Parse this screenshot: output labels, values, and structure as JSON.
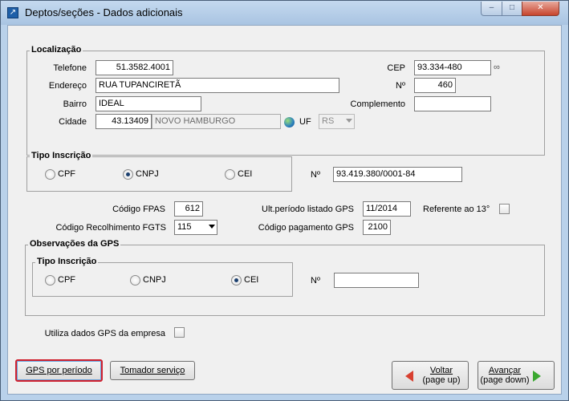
{
  "window": {
    "title": "Deptos/seções - Dados adicionais",
    "min": "–",
    "max": "□",
    "close": "✕"
  },
  "localizacao": {
    "title": "Localização",
    "telefone_label": "Telefone",
    "telefone": "51.3582.4001",
    "cep_label": "CEP",
    "cep": "93.334-480",
    "endereco_label": "Endereço",
    "endereco": "RUA TUPANCIRETÃ",
    "numero_label": "Nº",
    "numero": "460",
    "bairro_label": "Bairro",
    "bairro": "IDEAL",
    "complemento_label": "Complemento",
    "complemento": "",
    "cidade_label": "Cidade",
    "cidade_codigo": "43.13409",
    "cidade_nome": "NOVO HAMBURGO",
    "uf_label": "UF",
    "uf": "RS"
  },
  "tipo_inscricao": {
    "title": "Tipo Inscrição",
    "options": [
      "CPF",
      "CNPJ",
      "CEI"
    ],
    "selected": "CNPJ",
    "numero_label": "Nº",
    "numero": "93.419.380/0001-84"
  },
  "gps": {
    "fpas_label": "Código FPAS",
    "fpas": "612",
    "ult_periodo_label": "Ult.período listado GPS",
    "ult_periodo": "11/2014",
    "referente13_label": "Referente ao 13°",
    "referente13_checked": false,
    "recolhimento_label": "Código Recolhimento FGTS",
    "recolhimento": "115",
    "pagamento_label": "Código pagamento GPS",
    "pagamento": "2100"
  },
  "observacoes": {
    "title": "Observações da GPS",
    "tipo_title": "Tipo Inscrição",
    "options": [
      "CPF",
      "CNPJ",
      "CEI"
    ],
    "selected": "CEI",
    "numero_label": "Nº",
    "numero": ""
  },
  "utiliza_label": "Utiliza dados GPS da empresa",
  "utiliza_checked": false,
  "buttons": {
    "gps_periodo": "GPS por período",
    "tomador": "Tomador serviço",
    "voltar_1": "Voltar",
    "voltar_2": "(page up)",
    "avancar_1": "Avançar",
    "avancar_2": "(page down)"
  }
}
